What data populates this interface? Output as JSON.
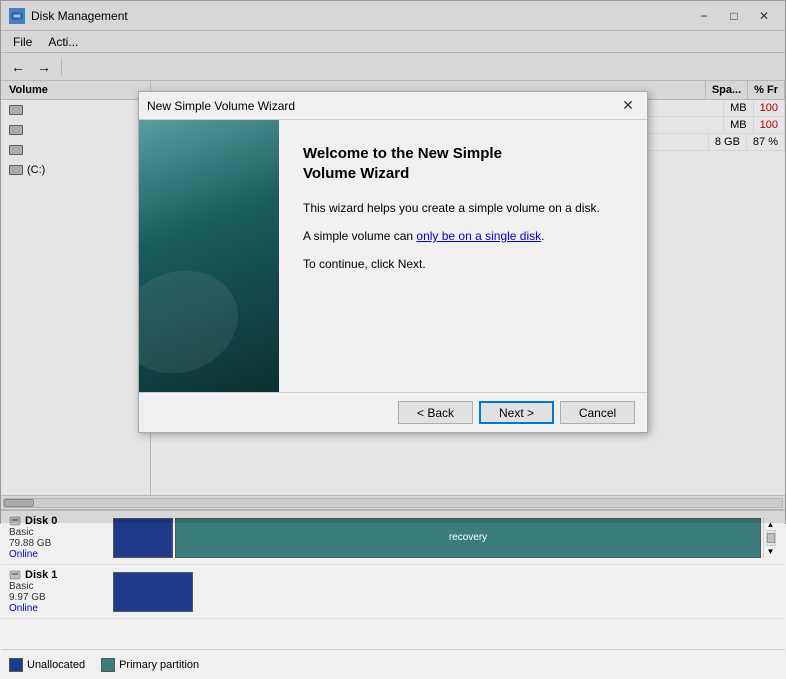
{
  "window": {
    "title": "Disk Management",
    "minimize_label": "−",
    "maximize_label": "□",
    "close_label": "✕"
  },
  "menubar": {
    "items": [
      {
        "label": "File"
      },
      {
        "label": "Acti..."
      }
    ]
  },
  "toolbar": {
    "back_label": "←",
    "forward_label": "→",
    "separator": "|"
  },
  "volume_panel": {
    "header": "Volume",
    "rows": [
      {
        "icon": true,
        "label": ""
      },
      {
        "icon": true,
        "label": ""
      },
      {
        "icon": true,
        "label": ""
      },
      {
        "icon": true,
        "label": "(C:)"
      }
    ]
  },
  "right_panel": {
    "headers": [
      "",
      "Spa...",
      "% Fr"
    ],
    "rows": [
      {
        "col1": "",
        "col2": "MB",
        "col3": "100"
      },
      {
        "col1": "",
        "col2": "MB",
        "col3": "100"
      },
      {
        "col1": "",
        "col2": "8 GB",
        "col3": "87 %"
      }
    ]
  },
  "disk_view": {
    "disks": [
      {
        "title": "Disk 0",
        "sub": "Basic",
        "size": "79.88 GB",
        "status": "Online",
        "bar_label": "recovery"
      },
      {
        "title": "Disk 1",
        "sub": "Basic",
        "size": "9.97 GB",
        "status": "Online"
      }
    ]
  },
  "status_bar": {
    "legend": [
      {
        "label": "Unallocated",
        "color": "#1f3a8a"
      },
      {
        "label": "Primary partition",
        "color": "#3a7d7b"
      }
    ]
  },
  "modal": {
    "title": "New Simple Volume Wizard",
    "close_label": "✕",
    "heading": "Welcome to the New Simple\nVolume Wizard",
    "para1": "This wizard helps you create a simple volume on a disk.",
    "para2_prefix": "A simple volume can ",
    "para2_link": "only be on a single disk",
    "para2_suffix": ".",
    "para3": "To continue, click Next.",
    "back_label": "< Back",
    "next_label": "Next >",
    "cancel_label": "Cancel"
  }
}
